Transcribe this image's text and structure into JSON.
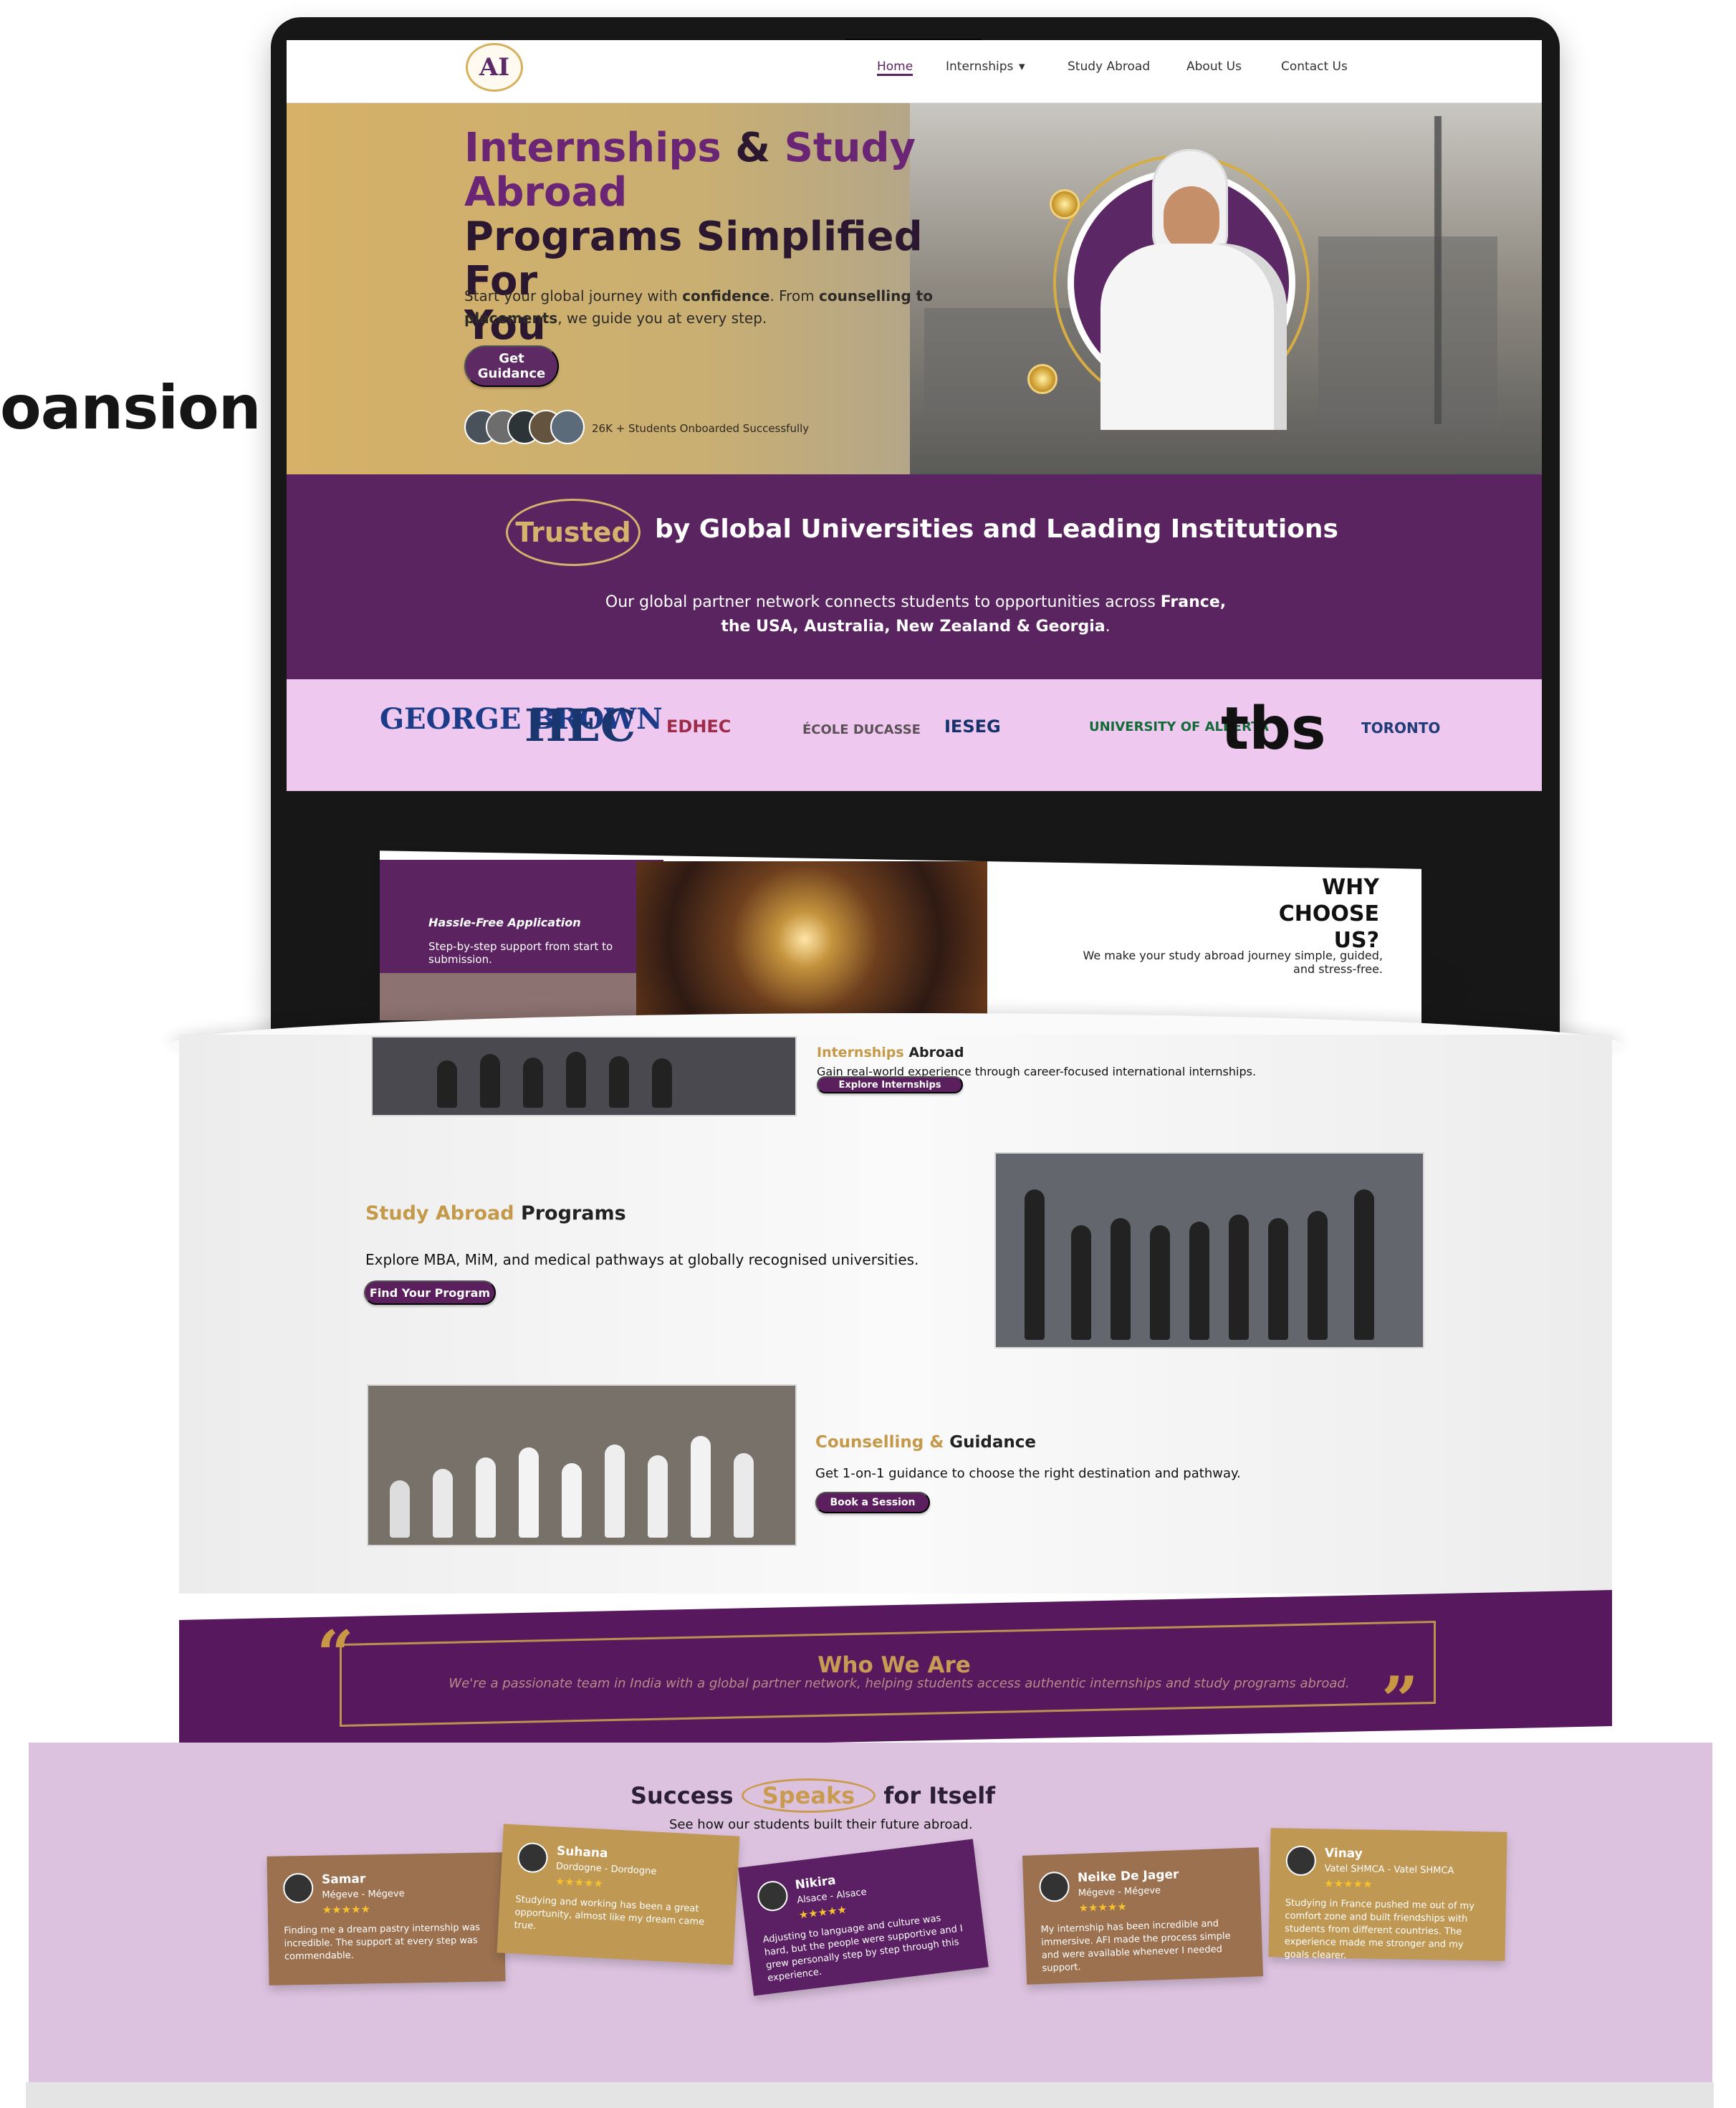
{
  "side_text": "oansion",
  "navigation": {
    "logo": "AI",
    "links": [
      "Home",
      "Internships",
      "Study Abroad",
      "About Us",
      "Contact Us"
    ],
    "dropdown": "▾"
  },
  "hero": {
    "title_line_1_accent": "Internships",
    "title_line_1_connector": " & ",
    "title_line_1_end": "Study Abroad",
    "title_line_2": "Programs Simplified For",
    "title_line_3": "You",
    "subtitle_start": "Start your global journey with ",
    "subtitle_strong_1": "confidence",
    "subtitle_mid": ". From ",
    "subtitle_strong_2": "counselling to placements",
    "subtitle_end": ", we guide you at every step.",
    "button": "Get Guidance",
    "student_count": "26K + Students Onboarded Successfully"
  },
  "trusted": {
    "badge": "Trusted",
    "title": "by Global Universities and Leading Institutions",
    "subtitle_start": "Our global partner network connects students to opportunities across ",
    "subtitle_strong": "France, the USA, Australia, New Zealand & Georgia",
    "subtitle_end": "."
  },
  "partners": [
    "GEORGE BROWN",
    "HEC",
    "EDHEC",
    "ÉCOLE DUCASSE",
    "IESEG",
    "UNIVERSITY OF ALBERTA",
    "tbs",
    "TORONTO"
  ],
  "why": {
    "title_1": "WHY",
    "title_2": "CHOOSE",
    "title_3": "US?",
    "subtitle": "We make your study abroad journey simple, guided, and stress-free.",
    "card_title": "Hassle-Free Application",
    "card_text": "Step-by-step support from start to submission."
  },
  "services": {
    "internship_title_1": "Internships",
    "internship_title_2": " Abroad",
    "internship_text": "Gain real-world experience through career-focused international internships.",
    "internship_button": "Explore Internships",
    "study_title_accent": "Study Abroad",
    "study_title_end": " Programs",
    "study_text": "Explore MBA, MiM, and medical pathways at globally recognised universities.",
    "study_button": "Find Your Program",
    "counselling_title_accent": "Counselling",
    "counselling_title_connector": " & ",
    "counselling_title_end": "Guidance",
    "counselling_text": "Get 1-on-1 guidance to choose the right destination and pathway.",
    "counselling_button": "Book a Session"
  },
  "who": {
    "title": "Who We Are",
    "text": "We're a passionate team in India with a global partner network, helping students access authentic internships and study programs abroad."
  },
  "success": {
    "title_start": "Success",
    "title_highlight": "Speaks",
    "title_end": "for Itself",
    "subtitle": "See how our students built their future abroad.",
    "reviews": [
      {
        "name": "Samar",
        "place": "Mégeve - Mégeve",
        "stars": "★★★★★",
        "text": "Finding me a dream pastry internship was incredible. The support at every step was commendable.",
        "color": "#9b7150"
      },
      {
        "name": "Suhana",
        "place": "Dordogne - Dordogne",
        "stars": "★★★★★",
        "text": "Studying and working has been a great opportunity, almost like my dream came true.",
        "color": "#bf9854"
      },
      {
        "name": "Nikira",
        "place": "Alsace - Alsace",
        "stars": "★★★★★",
        "text": "Adjusting to language and culture was hard, but the people were supportive and I grew personally step by step through this experience.",
        "color": "#5b1f63"
      },
      {
        "name": "Neike De Jager",
        "place": "Mégeve - Mégeve",
        "stars": "★★★★★",
        "text": "My internship has been incredible and immersive. AFI made the process simple and were available whenever I needed support.",
        "color": "#9b7150"
      },
      {
        "name": "Vinay",
        "place": "Vatel SHMCA - Vatel SHMCA",
        "stars": "★★★★★",
        "text": "Studying in France pushed me out of my comfort zone and built friendships with students from different countries. The experience made me stronger and my goals clearer.",
        "color": "#bf9854"
      }
    ]
  }
}
